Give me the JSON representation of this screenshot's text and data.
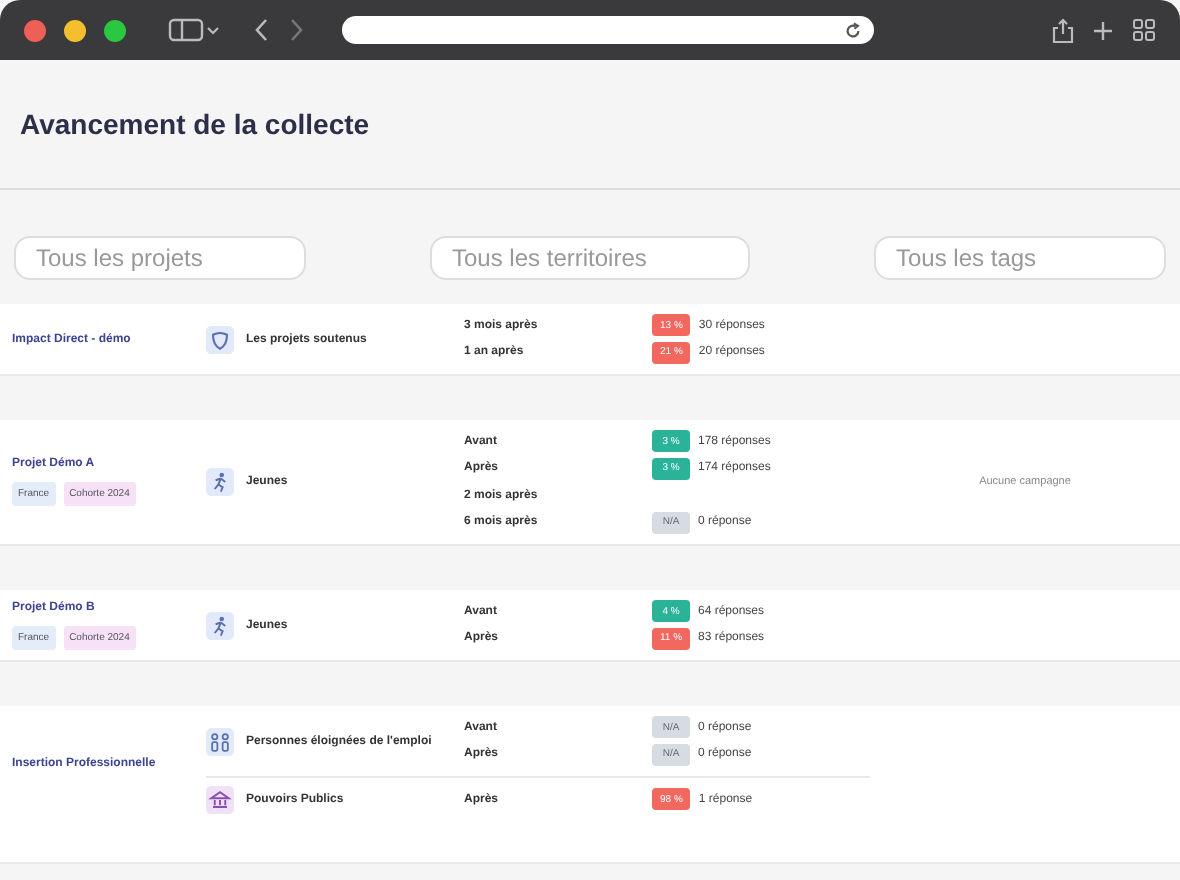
{
  "page": {
    "title": "Avancement de la collecte"
  },
  "filters": [
    {
      "placeholder": "Tous les projets"
    },
    {
      "placeholder": "Tous les territoires"
    },
    {
      "placeholder": "Tous les tags"
    }
  ],
  "groups": [
    {
      "project": "Impact Direct - démo",
      "segments": [
        {
          "name": "Les projets soutenus",
          "kind": "shield",
          "rows": [
            {
              "label": "3 mois après",
              "badge": "13 %",
              "color": "#f2685f",
              "responses": "30 réponses"
            },
            {
              "label": "1 an après",
              "badge": "21 %",
              "color": "#f2685f",
              "responses": "20 réponses"
            }
          ]
        }
      ]
    },
    {
      "project": "Projet Démo A",
      "tags": [
        {
          "label": "France",
          "color": "#e3ecf8"
        },
        {
          "label": "Cohorte 2024",
          "color": "#f6e1f6"
        }
      ],
      "note": "Aucune campagne",
      "segments": [
        {
          "name": "Jeunes",
          "kind": "runner",
          "rows": [
            {
              "label": "Avant",
              "badge": "3 %",
              "color": "#2bb39a",
              "responses": "178 réponses"
            },
            {
              "label": "Après",
              "badge": "3 %",
              "color": "#2bb39a",
              "responses": "174 réponses"
            },
            {
              "label": "2 mois après"
            },
            {
              "label": "6 mois après",
              "badge": "N/A",
              "color": "#d7dbe2",
              "responses": "0 réponse"
            }
          ]
        }
      ]
    },
    {
      "project": "Projet Démo B",
      "tags": [
        {
          "label": "France",
          "color": "#e3ecf8"
        },
        {
          "label": "Cohorte 2024",
          "color": "#f6e1f6"
        }
      ],
      "segments": [
        {
          "name": "Jeunes",
          "kind": "runner",
          "rows": [
            {
              "label": "Avant",
              "badge": "4 %",
              "color": "#2bb39a",
              "responses": "64 réponses"
            },
            {
              "label": "Après",
              "badge": "11 %",
              "color": "#f2685f",
              "responses": "83 réponses"
            }
          ]
        }
      ]
    },
    {
      "project": "Insertion Professionnelle",
      "segments": [
        {
          "name": "Personnes éloignées de l'emploi",
          "kind": "people",
          "rows": [
            {
              "label": "Avant",
              "badge": "N/A",
              "color": "#d7dbe2",
              "responses": "0 réponse"
            },
            {
              "label": "Après",
              "badge": "N/A",
              "color": "#d7dbe2",
              "responses": "0 réponse"
            }
          ]
        },
        {
          "name": "Pouvoirs Publics",
          "kind": "bank",
          "rows": [
            {
              "label": "Après",
              "badge": "98 %",
              "color": "#f2685f",
              "responses": "1 réponse"
            }
          ]
        }
      ]
    }
  ]
}
